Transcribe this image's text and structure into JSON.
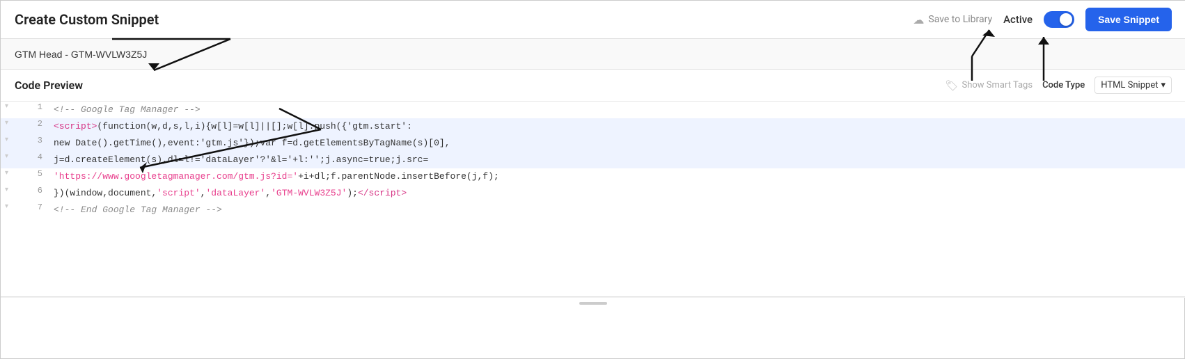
{
  "header": {
    "title": "Create Custom Snippet",
    "save_to_library_label": "Save to Library",
    "active_label": "Active",
    "save_snippet_label": "Save Snippet"
  },
  "snippet": {
    "name": "GTM Head - GTM-WVLW3Z5J"
  },
  "code_preview": {
    "title": "Code Preview",
    "show_smart_tags_label": "Show Smart Tags",
    "code_type_label": "Code Type",
    "code_type_value": "HTML Snippet",
    "lines": [
      {
        "number": "1",
        "html": "<span class='c-comment'>&lt;!-- Google Tag Manager --&gt;</span>"
      },
      {
        "number": "2",
        "html": "<span class='c-tag'>&lt;script&gt;</span><span class='c-dark'>(function(w,d,s,l,i){w[l]=w[l]||[];w[l].push({'gtm.start':</span>"
      },
      {
        "number": "3",
        "html": "<span class='c-dark'>new Date().getTime(),event:'gtm.js'});var f=d.getElementsByTagName(s)[0],</span>"
      },
      {
        "number": "4",
        "html": "<span class='c-dark'>j=d.createElement(s),dl=l!='dataLayer'?'&l='+l:'';j.async=true;j.src=</span>"
      },
      {
        "number": "5",
        "html": "<span class='c-string'>'https://www.googletagmanager.com/gtm.js?id='</span><span class='c-dark'>+i+dl;f.parentNode.insertBefore(j,f);</span>"
      },
      {
        "number": "6",
        "html": "<span class='c-dark'>})(window,document,</span><span class='c-string'>'script'</span><span class='c-dark'>,</span><span class='c-string'>'dataLayer'</span><span class='c-dark'>,</span><span class='c-string'>'GTM-WVLW3Z5J'</span><span class='c-dark'>);</span><span class='c-tag'>&lt;/script&gt;</span>"
      },
      {
        "number": "7",
        "html": "<span class='c-comment'>&lt;!-- End Google Tag Manager --&gt;</span>"
      }
    ]
  }
}
